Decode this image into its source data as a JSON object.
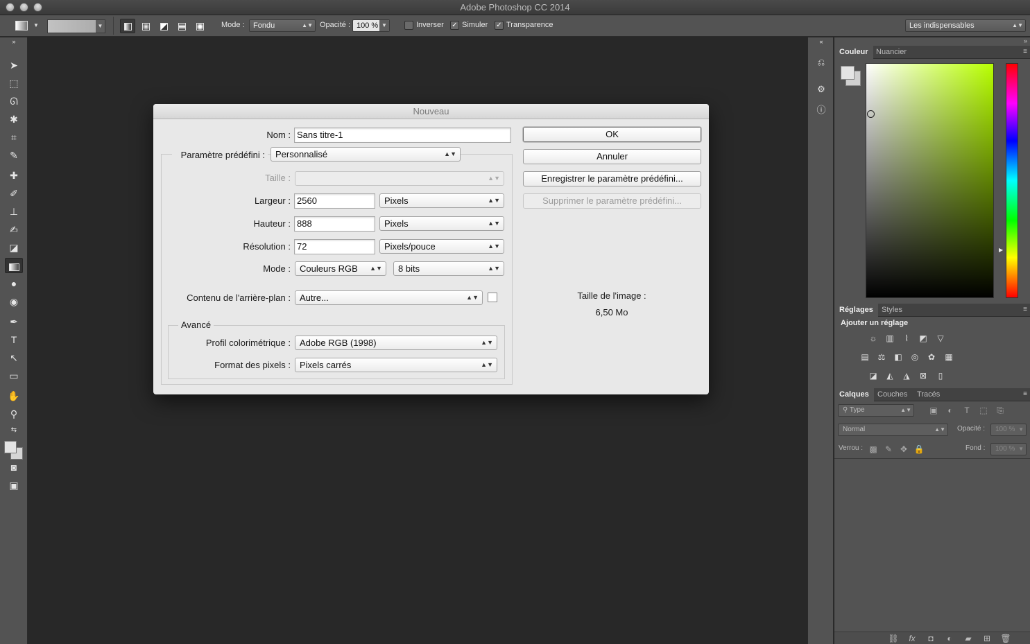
{
  "window": {
    "title": "Adobe Photoshop CC 2014"
  },
  "options_bar": {
    "mode_label": "Mode :",
    "mode_value": "Fondu",
    "opacity_label": "Opacité :",
    "opacity_value": "100 %",
    "invert_label": "Inverser",
    "invert_checked": false,
    "dither_label": "Simuler",
    "dither_checked": true,
    "transparency_label": "Transparence",
    "transparency_checked": true,
    "workspace": "Les indispensables"
  },
  "panels": {
    "color": {
      "tabs": [
        "Couleur",
        "Nuancier"
      ]
    },
    "adjustments": {
      "tabs": [
        "Réglages",
        "Styles"
      ],
      "add_label": "Ajouter un réglage"
    },
    "layers": {
      "tabs": [
        "Calques",
        "Couches",
        "Tracés"
      ],
      "filter_value": "Type",
      "blend_value": "Normal",
      "opacity_label": "Opacité :",
      "opacity_value": "100 %",
      "lock_label": "Verrou :",
      "fill_label": "Fond :",
      "fill_value": "100 %"
    }
  },
  "dialog": {
    "title": "Nouveau",
    "name_label": "Nom :",
    "name_value": "Sans titre-1",
    "preset_label": "Paramètre prédéfini :",
    "preset_value": "Personnalisé",
    "size_label": "Taille :",
    "size_value": "",
    "width_label": "Largeur :",
    "width_value": "2560",
    "width_unit": "Pixels",
    "height_label": "Hauteur :",
    "height_value": "888",
    "height_unit": "Pixels",
    "resolution_label": "Résolution :",
    "resolution_value": "72",
    "resolution_unit": "Pixels/pouce",
    "mode_label": "Mode :",
    "mode_value": "Couleurs RGB",
    "bits_value": "8 bits",
    "background_label": "Contenu de l'arrière-plan :",
    "background_value": "Autre...",
    "advanced_label": "Avancé",
    "profile_label": "Profil colorimétrique :",
    "profile_value": "Adobe RGB (1998)",
    "pixel_format_label": "Format des pixels :",
    "pixel_format_value": "Pixels carrés",
    "ok_label": "OK",
    "cancel_label": "Annuler",
    "save_preset_label": "Enregistrer le paramètre prédéfini...",
    "delete_preset_label": "Supprimer le paramètre prédéfini...",
    "image_size_label": "Taille de l'image :",
    "image_size_value": "6,50 Mo"
  },
  "colors": {
    "app_bg": "#282828",
    "panel_bg": "#535353",
    "dialog_bg": "#e8e8e8",
    "fg_swatch": "#d6d6d6"
  }
}
